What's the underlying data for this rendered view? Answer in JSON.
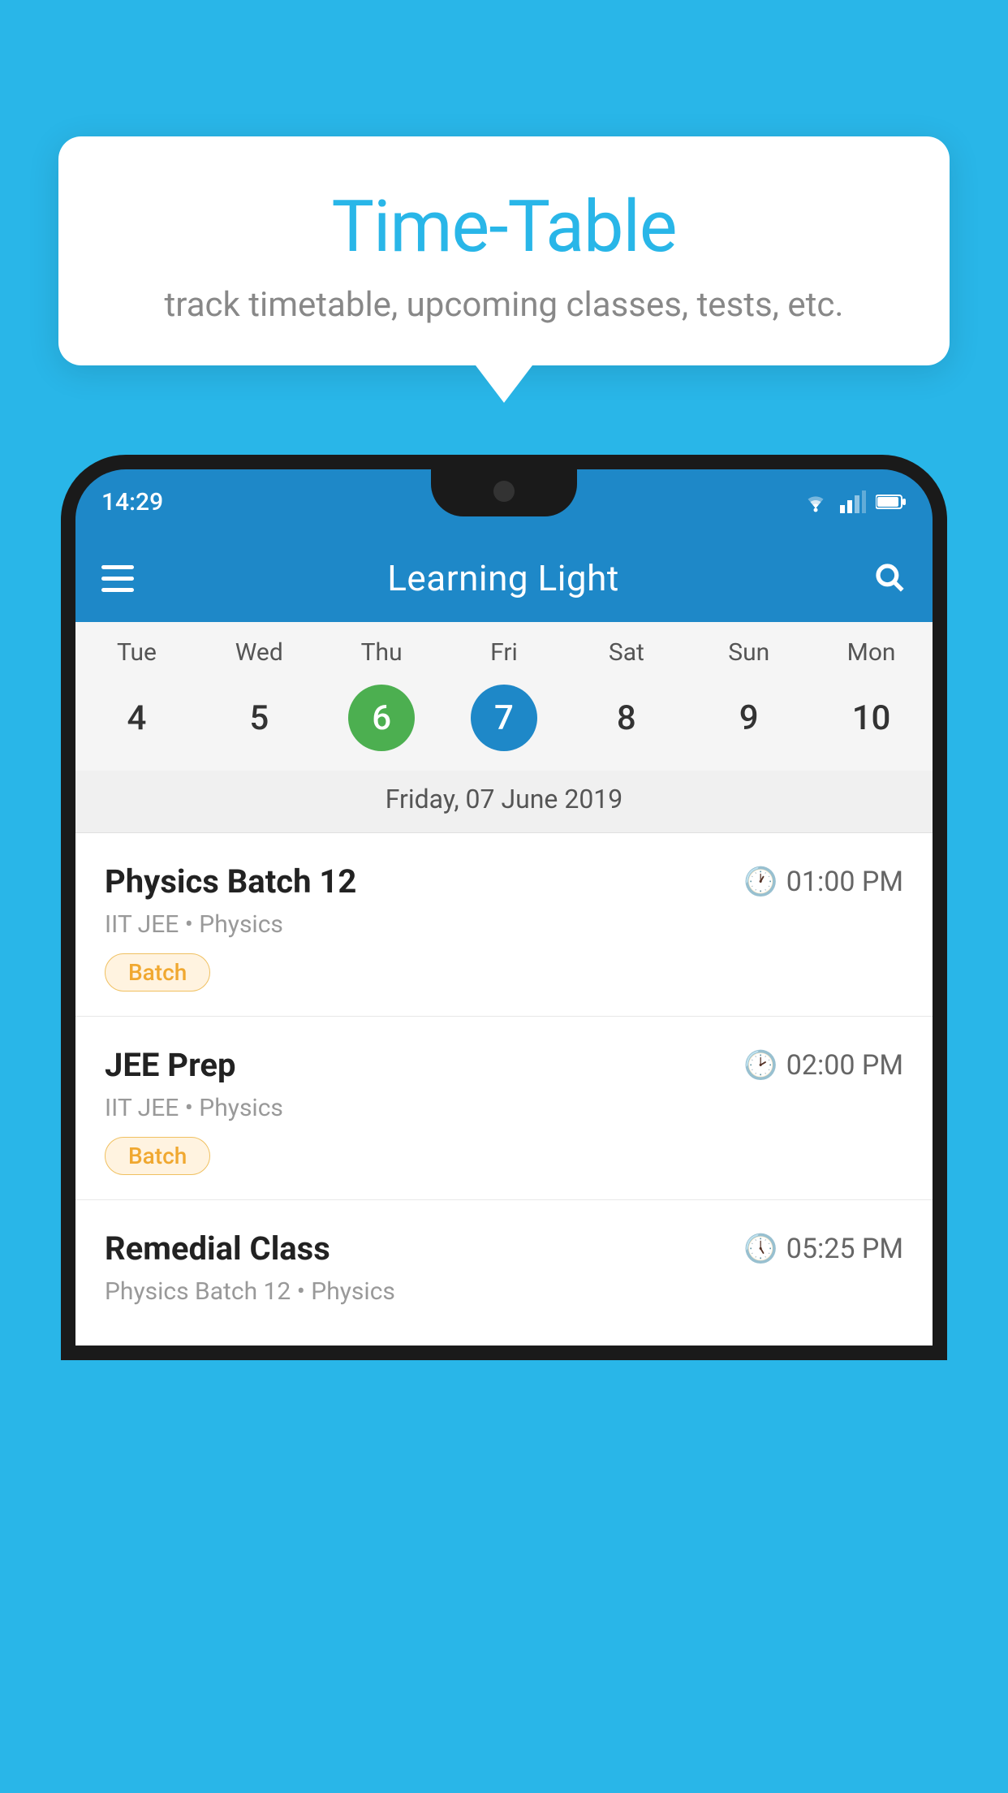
{
  "background_color": "#29b6e8",
  "card": {
    "title": "Time-Table",
    "subtitle": "track timetable, upcoming classes, tests, etc."
  },
  "phone": {
    "status_bar": {
      "time": "14:29"
    },
    "app_bar": {
      "title": "Learning Light"
    },
    "calendar": {
      "days": [
        "Tue",
        "Wed",
        "Thu",
        "Fri",
        "Sat",
        "Sun",
        "Mon"
      ],
      "dates": [
        {
          "num": "4",
          "state": "normal"
        },
        {
          "num": "5",
          "state": "normal"
        },
        {
          "num": "6",
          "state": "today"
        },
        {
          "num": "7",
          "state": "selected"
        },
        {
          "num": "8",
          "state": "normal"
        },
        {
          "num": "9",
          "state": "normal"
        },
        {
          "num": "10",
          "state": "normal"
        }
      ],
      "selected_date_label": "Friday, 07 June 2019"
    },
    "schedule": [
      {
        "title": "Physics Batch 12",
        "time": "01:00 PM",
        "meta": "IIT JEE • Physics",
        "badge": "Batch"
      },
      {
        "title": "JEE Prep",
        "time": "02:00 PM",
        "meta": "IIT JEE • Physics",
        "badge": "Batch"
      },
      {
        "title": "Remedial Class",
        "time": "05:25 PM",
        "meta": "Physics Batch 12 • Physics",
        "badge": null
      }
    ]
  }
}
